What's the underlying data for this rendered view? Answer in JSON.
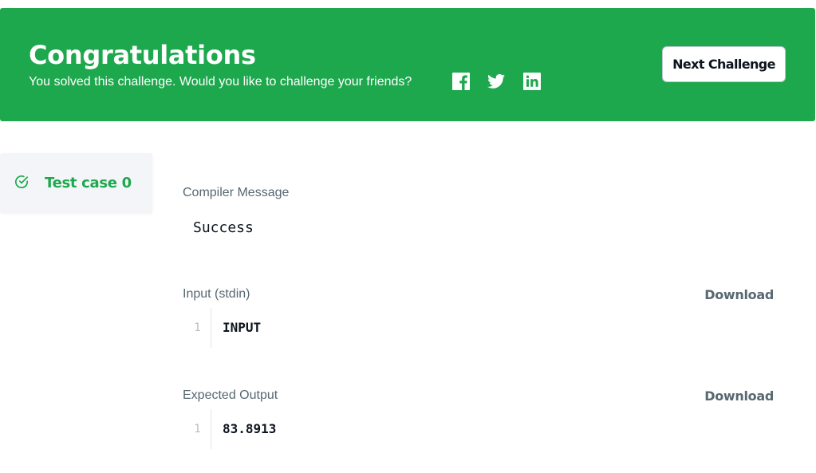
{
  "banner": {
    "title": "Congratulations",
    "subtitle": "You solved this challenge. Would you like to challenge your friends?",
    "share_icons": [
      "facebook-icon",
      "twitter-icon",
      "linkedin-icon"
    ],
    "next_button_label": "Next Challenge",
    "background_color": "#1ea84d"
  },
  "sidebar": {
    "test_cases": [
      {
        "label": "Test case 0",
        "status_icon": "check-circle-icon",
        "status_color": "#1ea84d"
      }
    ]
  },
  "compiler": {
    "label": "Compiler Message",
    "message": "Success"
  },
  "input": {
    "label": "Input (stdin)",
    "download_label": "Download",
    "lines": [
      {
        "number": "1",
        "text": "INPUT"
      }
    ]
  },
  "expected_output": {
    "label": "Expected Output",
    "download_label": "Download",
    "lines": [
      {
        "number": "1",
        "text": "83.8913"
      }
    ]
  }
}
